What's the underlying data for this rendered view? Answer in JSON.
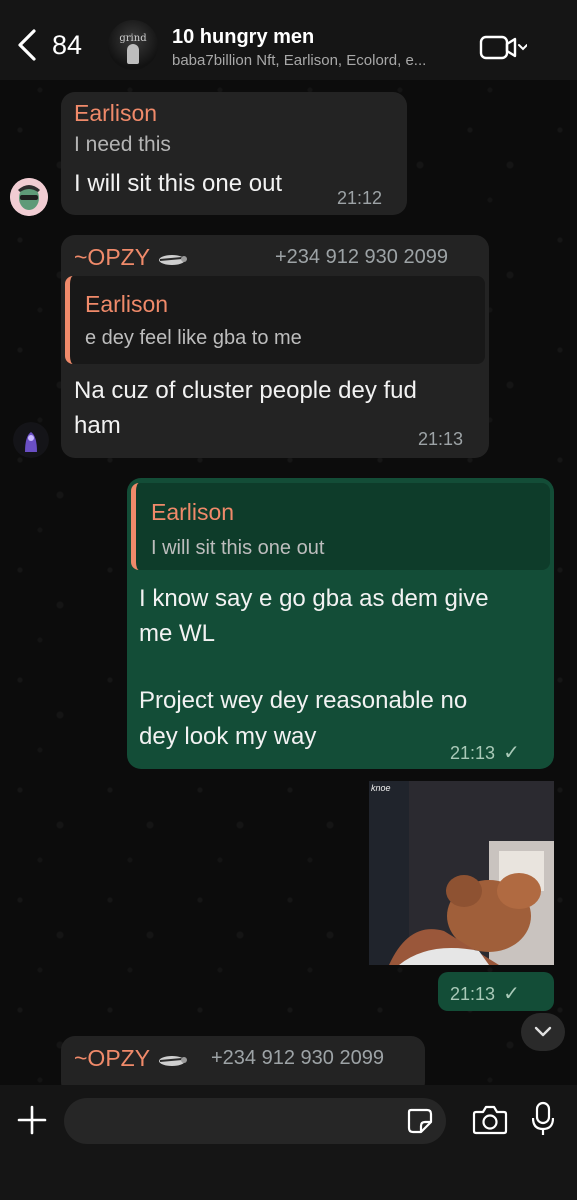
{
  "header": {
    "back_count": "84",
    "group_title": "10 hungry men",
    "group_subtitle": "baba7billion Nft, Earlison, Ecolord, e...",
    "avatar_text": "grind"
  },
  "messages": [
    {
      "sender": "Earlison",
      "reply_text": "I need this",
      "text": "I will sit this one out",
      "time": "21:12"
    },
    {
      "sender": "~OPZY",
      "phone": "+234 912 930 2099",
      "quote_name": "Earlison",
      "quote_text": "e dey feel like gba to me",
      "text_line1": "Na cuz of cluster people dey fud",
      "text_line2": "ham",
      "time": "21:13"
    },
    {
      "quote_name": "Earlison",
      "quote_text": "I will sit this one out",
      "text_line1": "I know say e go gba as dem give",
      "text_line2": "me WL",
      "text_line3": "Project wey dey reasonable no",
      "text_line4": "dey look my way",
      "time": "21:13",
      "status": "✓"
    },
    {
      "media_caption": "knoe",
      "time": "21:13",
      "status": "✓"
    },
    {
      "sender": "~OPZY",
      "phone": "+234 912 930 2099"
    }
  ],
  "colors": {
    "sender_accent": "#f08a6a",
    "outgoing_bubble": "#134d37",
    "incoming_bubble": "#232323"
  },
  "icons": {
    "back": "chevron-left-icon",
    "video": "video-camera-icon",
    "plus": "plus-icon",
    "sticker": "sticker-icon",
    "camera": "camera-icon",
    "mic": "microphone-icon",
    "scroll_down": "chevron-down-icon"
  }
}
